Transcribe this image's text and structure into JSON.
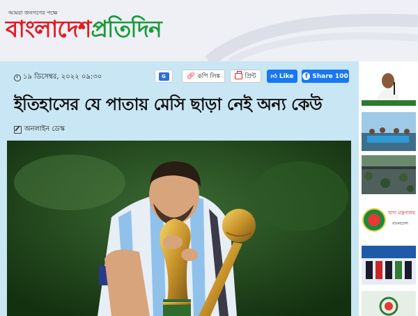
{
  "header": {
    "tagline": "আমরা জনগণের পক্ষে",
    "logo_part1": "বাংলাদেশ",
    "logo_part2": "প্রতিদিন",
    "colors": {
      "logo_red": "#e21b23",
      "logo_green": "#1a9a3a"
    }
  },
  "article": {
    "date": "১৯ ডিসেম্বর, ২০২২ ০৯:৩০",
    "headline": "ইতিহাসের যে পাতায় মেসি ছাড়া নেই অন্য কেউ",
    "author": "অনলাইন ডেস্ক",
    "hero_image_icon": "photo-messi-trophy"
  },
  "toolbar": {
    "google_news_label": "G",
    "copy_link_label": "কপি লিঙ্ক",
    "print_label": "প্রিন্ট",
    "like_label": "Like",
    "share_label": "Share 100",
    "colors": {
      "facebook_blue": "#1877f2",
      "accent_red": "#e21b23"
    }
  },
  "sidebar": {
    "ministry_label": "খাদ্য মন্ত্রণালয়",
    "ministry_sub": "বাংলাদেশ",
    "thumb_icons": [
      "photo-speaker",
      "photo-rally",
      "photo-water-hyacinth",
      "logo-food-ministry",
      "photo-ceremony",
      "photo-partial"
    ]
  }
}
